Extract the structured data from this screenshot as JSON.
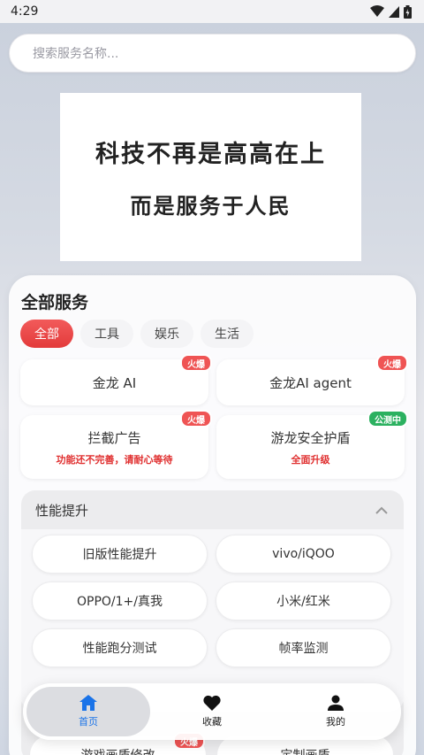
{
  "status": {
    "time": "4:29"
  },
  "search": {
    "placeholder": "搜索服务名称..."
  },
  "banner": {
    "line1": "科技不再是高高在上",
    "line2": "而是服务于人民"
  },
  "section": {
    "title": "全部服务"
  },
  "tabs": [
    {
      "label": "全部",
      "active": true
    },
    {
      "label": "工具",
      "active": false
    },
    {
      "label": "娱乐",
      "active": false
    },
    {
      "label": "生活",
      "active": false
    }
  ],
  "cards": [
    {
      "title": "金龙 AI",
      "badge": "火爆"
    },
    {
      "title": "金龙AI agent",
      "badge": "火爆"
    },
    {
      "title": "拦截广告",
      "subtitle": "功能还不完善，请耐心等待",
      "badge": "火爆"
    },
    {
      "title": "游龙安全护盾",
      "subtitle": "全面升级",
      "badge": "公测中"
    }
  ],
  "group": {
    "title": "性能提升",
    "items": [
      "旧版性能提升",
      "vivo/iQOO",
      "OPPO/1+/真我",
      "小米/红米",
      "性能跑分测试",
      "帧率监测"
    ]
  },
  "under": {
    "items": [
      "游戏画质修改",
      "定制画质"
    ],
    "badge": "火爆"
  },
  "nav": [
    {
      "label": "首页",
      "icon": "home-icon",
      "active": true
    },
    {
      "label": "收藏",
      "icon": "heart-icon",
      "active": false
    },
    {
      "label": "我的",
      "icon": "person-icon",
      "active": false
    }
  ],
  "colors": {
    "accent": "#e33b3b",
    "active_nav": "#1a73e8",
    "beta": "#2cb160"
  }
}
